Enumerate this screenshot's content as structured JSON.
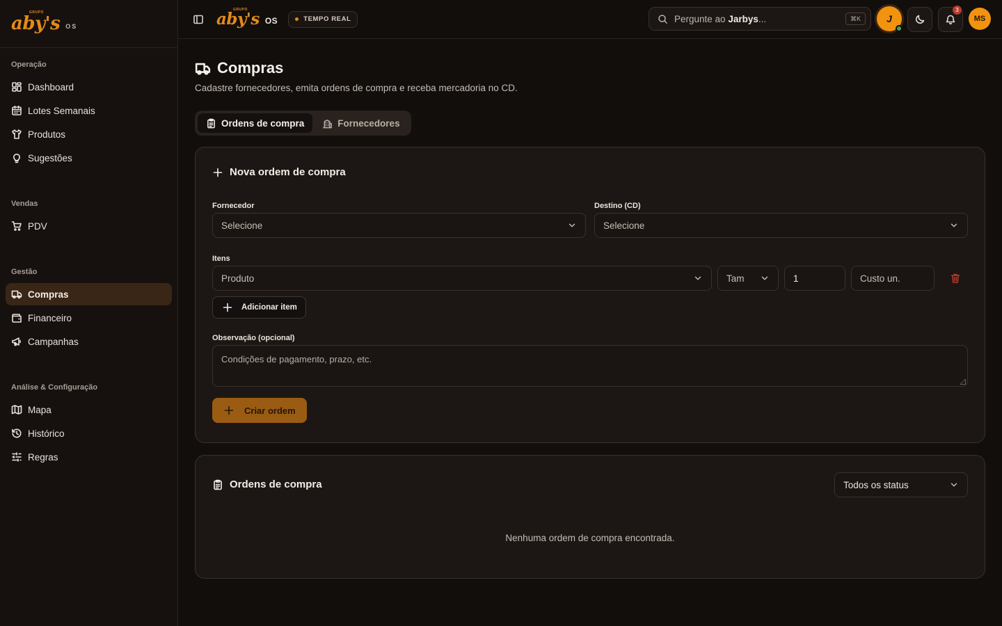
{
  "brand": {
    "grupo": "GRUPO",
    "name": "aby's",
    "suffix_sidebar": "OS",
    "suffix_header": "OS",
    "accent_color": "#e48a19"
  },
  "sidebar": {
    "sections": [
      {
        "title": "Operação",
        "items": [
          {
            "label": "Dashboard",
            "icon": "dashboard-icon"
          },
          {
            "label": "Lotes Semanais",
            "icon": "calendar-icon"
          },
          {
            "label": "Produtos",
            "icon": "shirt-icon"
          },
          {
            "label": "Sugestões",
            "icon": "lightbulb-icon"
          }
        ]
      },
      {
        "title": "Vendas",
        "items": [
          {
            "label": "PDV",
            "icon": "cart-icon"
          }
        ]
      },
      {
        "title": "Gestão",
        "items": [
          {
            "label": "Compras",
            "icon": "truck-icon",
            "active": true
          },
          {
            "label": "Financeiro",
            "icon": "wallet-icon"
          },
          {
            "label": "Campanhas",
            "icon": "megaphone-icon"
          }
        ]
      },
      {
        "title": "Análise & Configuração",
        "items": [
          {
            "label": "Mapa",
            "icon": "map-icon"
          },
          {
            "label": "Histórico",
            "icon": "history-icon"
          },
          {
            "label": "Regras",
            "icon": "sliders-icon"
          }
        ]
      }
    ]
  },
  "header": {
    "live_badge": "TEMPO REAL",
    "search": {
      "prefix": "Pergunte ao ",
      "name": "Jarbys",
      "suffix": "...",
      "shortcut": "⌘K"
    },
    "jarbys_initial": "J",
    "notifications_count": "3",
    "avatar_initials": "MS"
  },
  "page": {
    "title": "Compras",
    "subtitle": "Cadastre fornecedores, emita ordens de compra e receba mercadoria no CD.",
    "tabs": [
      {
        "label": "Ordens de compra",
        "active": true
      },
      {
        "label": "Fornecedores",
        "active": false
      }
    ]
  },
  "new_order": {
    "title": "Nova ordem de compra",
    "supplier_label": "Fornecedor",
    "supplier_value": "Selecione",
    "destination_label": "Destino (CD)",
    "destination_value": "Selecione",
    "items_label": "Itens",
    "item_row": {
      "product": "Produto",
      "size": "Tam",
      "quantity": "1",
      "unit_cost_placeholder": "Custo un."
    },
    "add_item_label": "Adicionar item",
    "note_label": "Observação (opcional)",
    "note_placeholder": "Condições de pagamento, prazo, etc.",
    "create_label": "Criar ordem"
  },
  "orders_list": {
    "title": "Ordens de compra",
    "status_filter": "Todos os status",
    "empty_message": "Nenhuma ordem de compra encontrada."
  }
}
